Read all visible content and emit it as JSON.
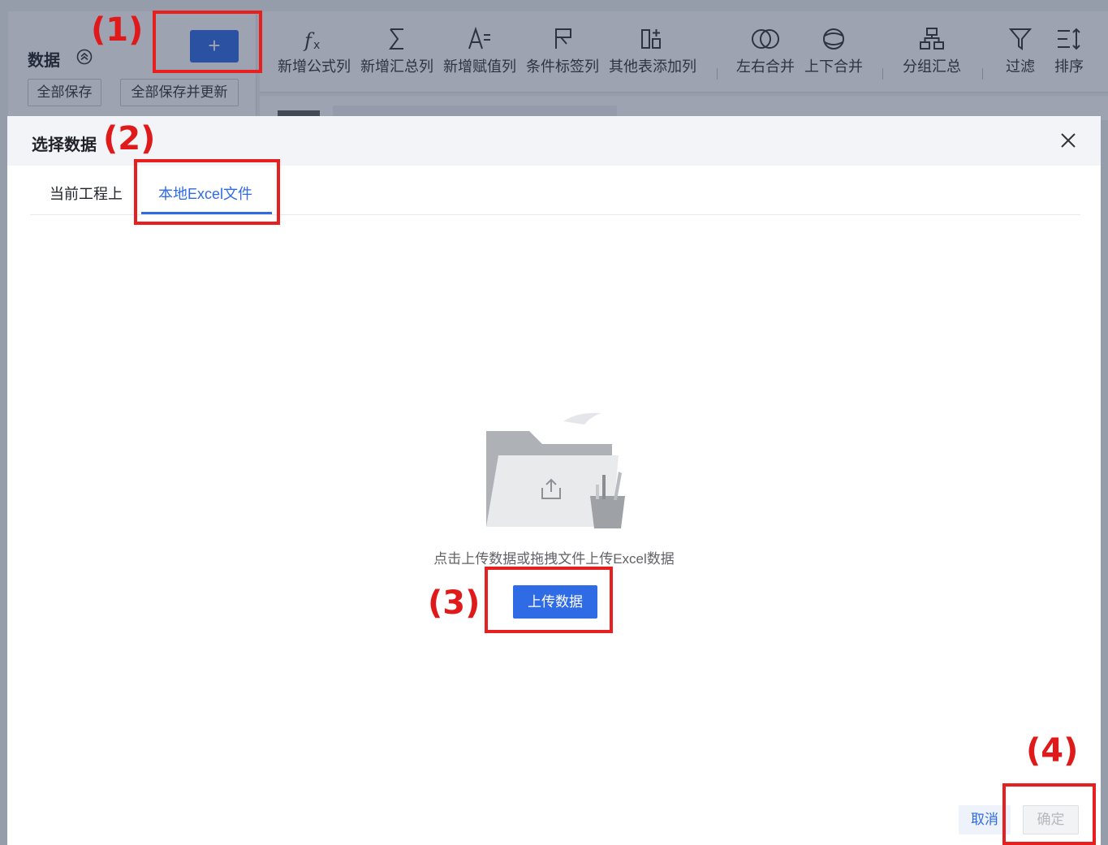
{
  "app": {
    "panel_title": "数据",
    "add_button": "+",
    "save_all": "全部保存",
    "save_and_update": "全部保存并更新",
    "toolbar": [
      {
        "label": "新增公式列",
        "icon": "formula-icon"
      },
      {
        "label": "新增汇总列",
        "icon": "sigma-icon"
      },
      {
        "label": "新增赋值列",
        "icon": "assign-icon"
      },
      {
        "label": "条件标签列",
        "icon": "flag-icon"
      },
      {
        "label": "其他表添加列",
        "icon": "add-column-icon"
      },
      {
        "label": "左右合并",
        "icon": "merge-horizontal-icon"
      },
      {
        "label": "上下合并",
        "icon": "merge-vertical-icon"
      },
      {
        "label": "分组汇总",
        "icon": "group-icon"
      },
      {
        "label": "过滤",
        "icon": "filter-icon"
      },
      {
        "label": "排序",
        "icon": "sort-icon"
      }
    ]
  },
  "dialog": {
    "title": "选择数据",
    "tabs": [
      "当前工程上",
      "本地Excel文件"
    ],
    "active_tab": 1,
    "upload_hint": "点击上传数据或拖拽文件上传Excel数据",
    "upload_button": "上传数据",
    "cancel": "取消",
    "confirm": "确定"
  },
  "annotations": [
    "(1)",
    "(2)",
    "(3)",
    "(4)"
  ],
  "colors": {
    "accent": "#2f6be5",
    "annotation": "#e81f1f",
    "overlay": "rgba(38,50,80,0.45)"
  }
}
